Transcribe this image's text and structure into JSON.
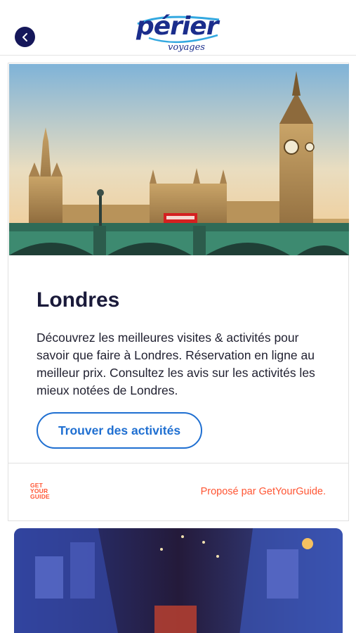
{
  "header": {
    "back_icon": "chevron-left-icon",
    "logo_main": "périer",
    "logo_sub": "voyages"
  },
  "card": {
    "title": "Londres",
    "description": "Découvrez les meilleures visites & activités pour savoir que faire à Londres. Réservation en ligne au meilleur prix. Consultez les avis sur les activités les mieux notées de Londres.",
    "cta_label": "Trouver des activités",
    "partner_logo": "GET YOUR GUIDE",
    "partner_text": "Proposé par GetYourGuide."
  },
  "colors": {
    "brand_navy": "#15175a",
    "cta_blue": "#1f6fd1",
    "partner_orange": "#ff5533"
  }
}
